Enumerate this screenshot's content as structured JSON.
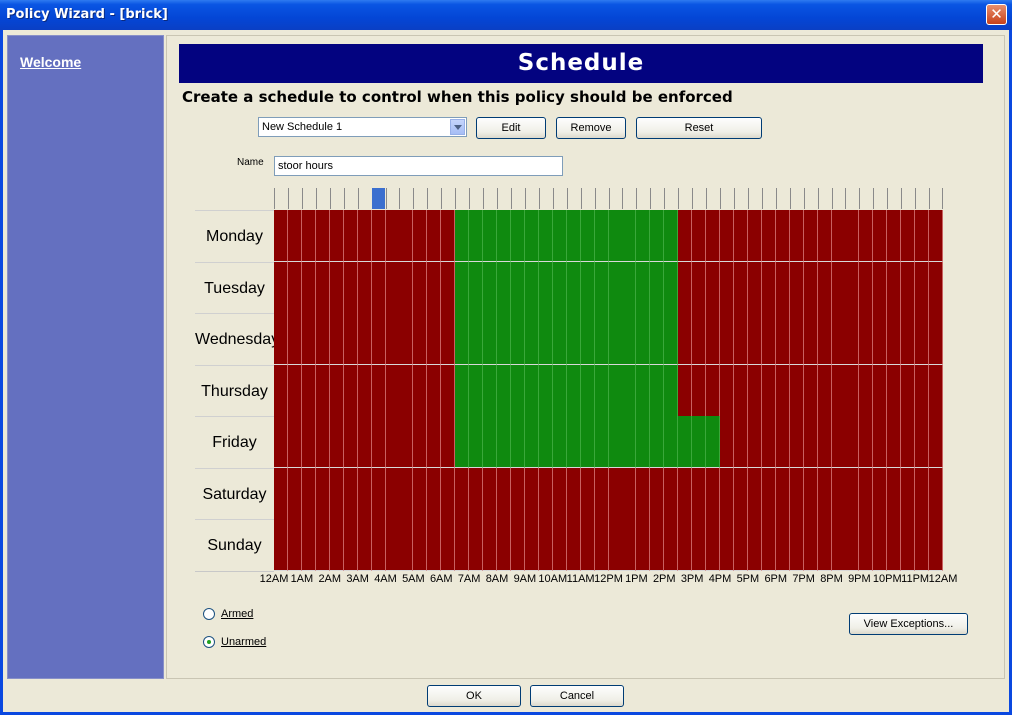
{
  "window": {
    "title": "Policy Wizard - [brick]",
    "close_glyph": "✕"
  },
  "sidebar": {
    "items": [
      {
        "label": "Welcome"
      }
    ]
  },
  "page": {
    "title": "Schedule",
    "subtitle": "Create a schedule to control when this policy should be enforced"
  },
  "schedule_select": {
    "value": "New Schedule 1"
  },
  "buttons": {
    "edit": "Edit",
    "remove": "Remove",
    "reset": "Reset",
    "view_exceptions": "View Exceptions...",
    "ok": "OK",
    "cancel": "Cancel"
  },
  "name_field": {
    "label": "Name",
    "value": "stoor hours"
  },
  "schedule_grid": {
    "slots_per_day": 48,
    "selected_slot": 7,
    "days": [
      "Monday",
      "Tuesday",
      "Wednesday",
      "Thursday",
      "Friday",
      "Saturday",
      "Sunday"
    ],
    "hours": [
      "12AM",
      "1AM",
      "2AM",
      "3AM",
      "4AM",
      "5AM",
      "6AM",
      "7AM",
      "8AM",
      "9AM",
      "10AM",
      "11AM",
      "12PM",
      "1PM",
      "2PM",
      "3PM",
      "4PM",
      "5PM",
      "6PM",
      "7PM",
      "8PM",
      "9PM",
      "10PM",
      "11PM",
      "12AM"
    ],
    "active_slots": {
      "Monday": [
        13,
        28
      ],
      "Tuesday": [
        13,
        28
      ],
      "Wednesday": [
        13,
        28
      ],
      "Thursday": [
        13,
        28
      ],
      "Friday": [
        13,
        31
      ],
      "Saturday": null,
      "Sunday": null
    },
    "colors": {
      "inactive": "#8b0000",
      "active": "#0f8a0f"
    }
  },
  "mode": {
    "options": [
      {
        "label": "Armed",
        "checked": false
      },
      {
        "label": "Unarmed",
        "checked": true
      }
    ]
  }
}
